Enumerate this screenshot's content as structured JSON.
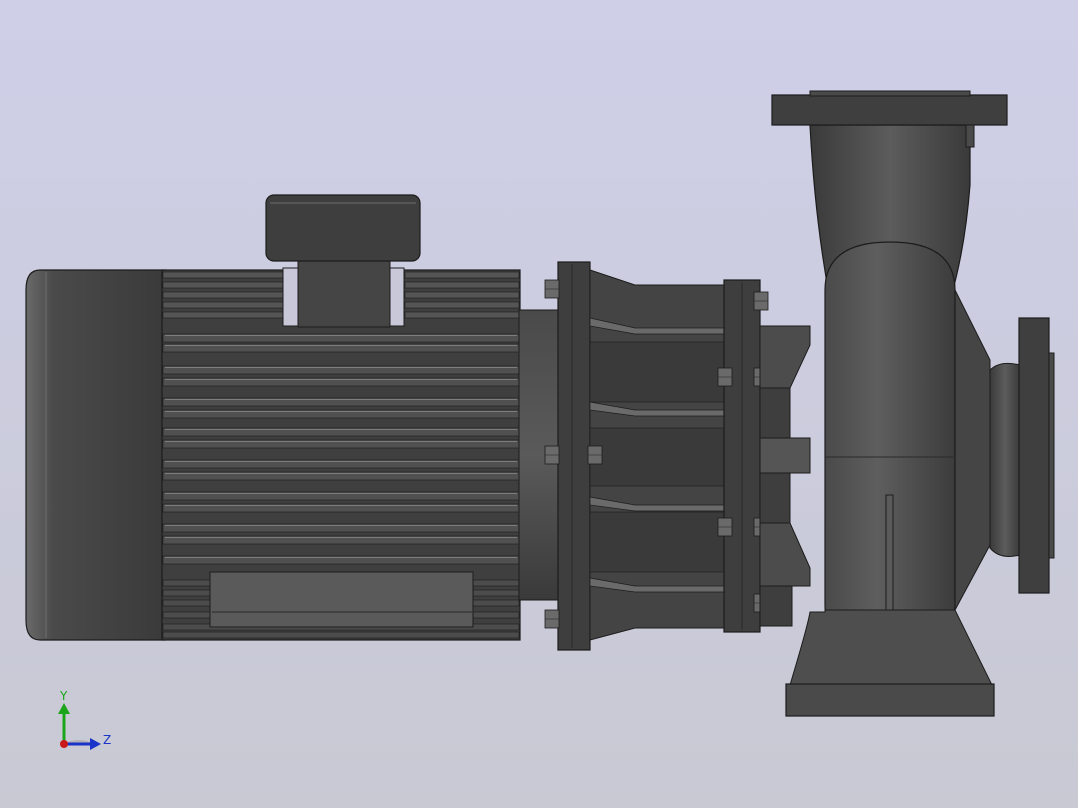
{
  "viewport": {
    "background_top": "#cfcfe8",
    "background_bottom": "#c8c9d3"
  },
  "colors": {
    "metal_dark": "#3b3b3b",
    "metal_mid": "#555555",
    "metal_light": "#7a7a7a",
    "outline": "#1c1c1c",
    "fin_highlight": "#8c8c8c",
    "bolt": "#6a6a6a"
  },
  "triad": {
    "y_label": "Y",
    "z_label": "Z",
    "y_color": "#1aa51a",
    "z_color": "#1a33c8",
    "origin_color": "#c81a1a"
  },
  "model": {
    "parts": [
      "motor-housing",
      "terminal-box",
      "cooling-fins",
      "lantern-bracket",
      "coupling-flange",
      "pump-casing",
      "discharge-flange",
      "suction-flange",
      "foot-support"
    ]
  }
}
